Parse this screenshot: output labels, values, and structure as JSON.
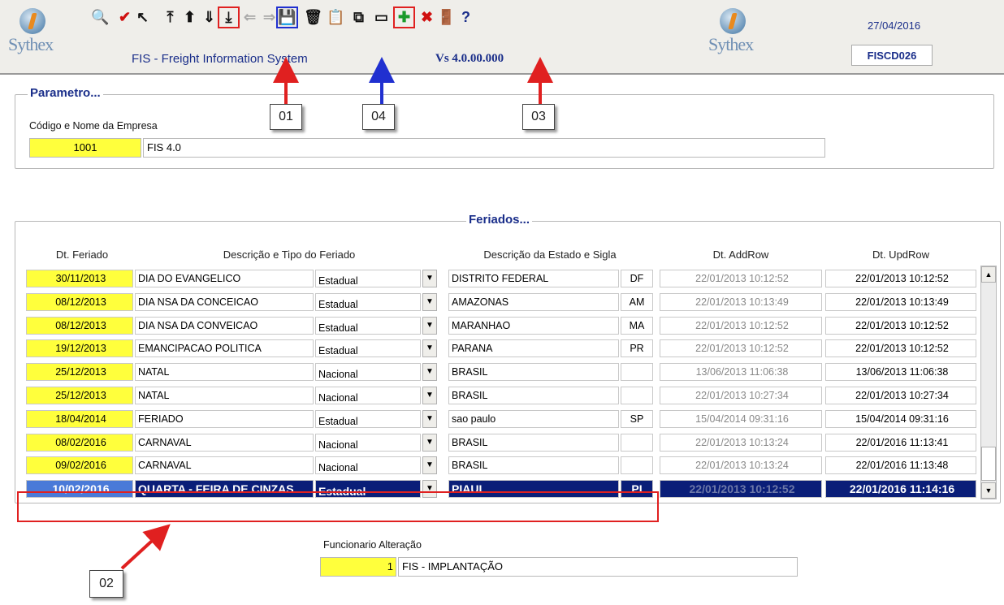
{
  "header": {
    "logo_text": "Sythex",
    "app_title": "FIS - Freight Information System",
    "version": "Vs 4.0.00.000",
    "date": "27/04/2016",
    "screen_code": "FISCD026",
    "toolbar": [
      {
        "icon": "search-icon",
        "glyph": "🔍"
      },
      {
        "icon": "checkmark-icon",
        "glyph": "✔"
      },
      {
        "icon": "cursor-icon",
        "glyph": "↖"
      },
      {
        "icon": "first-record-icon",
        "glyph": "⤒"
      },
      {
        "icon": "previous-record-icon",
        "glyph": "⬆"
      },
      {
        "icon": "next-record-icon",
        "glyph": "⇓"
      },
      {
        "icon": "last-record-icon",
        "glyph": "⤓"
      },
      {
        "icon": "arrow-left-icon",
        "glyph": "⇐"
      },
      {
        "icon": "arrow-right-icon",
        "glyph": "⇒"
      },
      {
        "icon": "save-icon",
        "glyph": "💾"
      },
      {
        "icon": "trash-icon",
        "glyph": "🗑"
      },
      {
        "icon": "clipboard-icon",
        "glyph": "📋"
      },
      {
        "icon": "copy-icon",
        "glyph": "⧉"
      },
      {
        "icon": "window-icon",
        "glyph": "▭"
      },
      {
        "icon": "add-record-icon",
        "glyph": "✚"
      },
      {
        "icon": "delete-record-icon",
        "glyph": "✖"
      },
      {
        "icon": "exit-door-icon",
        "glyph": "🚪"
      },
      {
        "icon": "help-icon",
        "glyph": "?"
      }
    ]
  },
  "parametro": {
    "title": "Parametro...",
    "label": "Código e Nome da Empresa",
    "code": "1001",
    "name": "FIS 4.0"
  },
  "feriados": {
    "title": "Feriados...",
    "headers": {
      "date": "Dt. Feriado",
      "desc": "Descrição e Tipo do Feriado",
      "estado": "Descrição da Estado e Sigla",
      "add": "Dt. AddRow",
      "upd": "Dt. UpdRow"
    },
    "rows": [
      {
        "date": "30/11/2013",
        "desc": "DIA DO EVANGELICO",
        "tipo": "Estadual",
        "estado": "DISTRITO FEDERAL",
        "sigla": "DF",
        "add": "22/01/2013 10:12:52",
        "upd": "22/01/2013 10:12:52"
      },
      {
        "date": "08/12/2013",
        "desc": "DIA NSA DA CONCEICAO",
        "tipo": "Estadual",
        "estado": "AMAZONAS",
        "sigla": "AM",
        "add": "22/01/2013 10:13:49",
        "upd": "22/01/2013 10:13:49"
      },
      {
        "date": "08/12/2013",
        "desc": "DIA NSA DA CONVEICAO",
        "tipo": "Estadual",
        "estado": "MARANHAO",
        "sigla": "MA",
        "add": "22/01/2013 10:12:52",
        "upd": "22/01/2013 10:12:52"
      },
      {
        "date": "19/12/2013",
        "desc": "EMANCIPACAO POLITICA",
        "tipo": "Estadual",
        "estado": "PARANA",
        "sigla": "PR",
        "add": "22/01/2013 10:12:52",
        "upd": "22/01/2013 10:12:52"
      },
      {
        "date": "25/12/2013",
        "desc": "NATAL",
        "tipo": "Nacional",
        "estado": "BRASIL",
        "sigla": "",
        "add": "13/06/2013 11:06:38",
        "upd": "13/06/2013 11:06:38"
      },
      {
        "date": "25/12/2013",
        "desc": "NATAL",
        "tipo": "Nacional",
        "estado": "BRASIL",
        "sigla": "",
        "add": "22/01/2013 10:27:34",
        "upd": "22/01/2013 10:27:34"
      },
      {
        "date": "18/04/2014",
        "desc": "FERIADO",
        "tipo": "Estadual",
        "estado": "sao paulo",
        "sigla": "SP",
        "add": "15/04/2014 09:31:16",
        "upd": "15/04/2014 09:31:16"
      },
      {
        "date": "08/02/2016",
        "desc": "CARNAVAL",
        "tipo": "Nacional",
        "estado": "BRASIL",
        "sigla": "",
        "add": "22/01/2013 10:13:24",
        "upd": "22/01/2016 11:13:41"
      },
      {
        "date": "09/02/2016",
        "desc": "CARNAVAL",
        "tipo": "Nacional",
        "estado": "BRASIL",
        "sigla": "",
        "add": "22/01/2013 10:13:24",
        "upd": "22/01/2016 11:13:48"
      },
      {
        "date": "10/02/2016",
        "desc": "QUARTA - FEIRA DE CINZAS",
        "tipo": "Estadual",
        "estado": "PIAUI",
        "sigla": "PI",
        "add": "22/01/2013 10:12:52",
        "upd": "22/01/2016 11:14:16",
        "selected": true
      }
    ]
  },
  "funcionario": {
    "label": "Funcionario Alteração",
    "code": "1",
    "name": "FIS - IMPLANTAÇÃO"
  },
  "annotations": {
    "a01": "01",
    "a02": "02",
    "a03": "03",
    "a04": "04"
  },
  "colors": {
    "highlight_red": "#e02020",
    "highlight_blue": "#2030d0",
    "selected_row": "#0a1e78",
    "key_field": "#ffff3c"
  }
}
